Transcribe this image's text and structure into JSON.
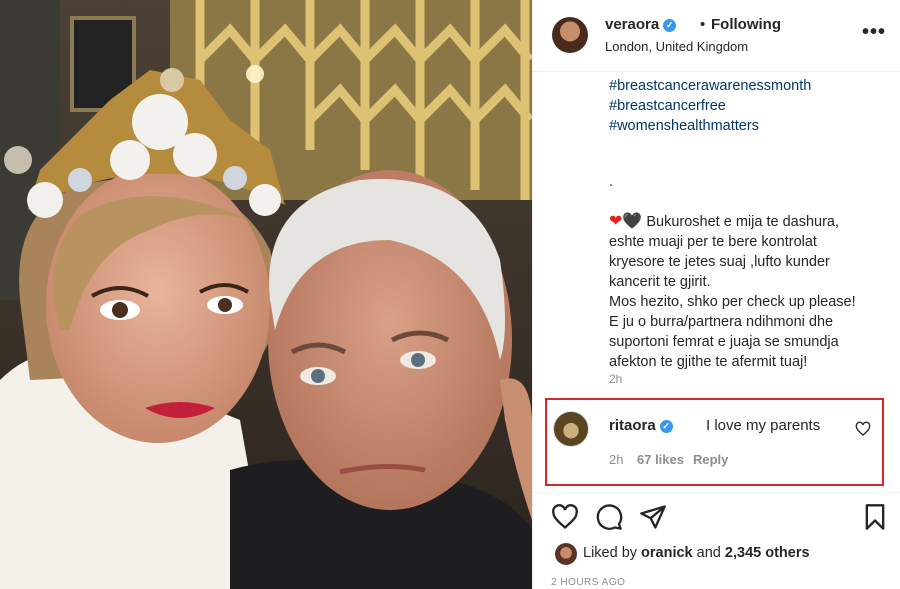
{
  "post": {
    "username": "veraora",
    "separator": "•",
    "follow_status": "Following",
    "location": "London, United Kingdom",
    "more_label": "•••"
  },
  "caption": {
    "hashtags": [
      "#breastcancerawarenessmonth",
      "#breastcancerfree",
      "#womenshealthmatters"
    ],
    "dot": ".",
    "hearts": [
      "❤",
      "🖤"
    ],
    "lines": [
      "Bukuroshet e mija te dashura,",
      "eshte muaji per te bere kontrolat",
      "kryesore te jetes suaj ,lufto kunder",
      "kancerit te gjirit.",
      "Mos hezito, shko per check up please!",
      "E ju o burra/partnera ndihmoni dhe",
      "suportoni femrat e juaja se smundja",
      "afekton te gjithe te afermit tuaj!"
    ],
    "time": "2h"
  },
  "comment": {
    "username": "ritaora",
    "text": "I love my parents",
    "time": "2h",
    "likes": "67 likes",
    "reply": "Reply"
  },
  "likes": {
    "prefix": "Liked by",
    "user": "oranick",
    "joiner": "and",
    "count": "2,345 others"
  },
  "date": "2 HOURS AGO",
  "icons": {
    "verified": "verified-badge-icon",
    "like": "heart-outline-icon",
    "comment": "comment-bubble-icon",
    "share": "paper-plane-icon",
    "save": "bookmark-icon"
  },
  "colors": {
    "hashtag": "#00376b",
    "highlight_border": "#d8262c",
    "verified": "#3897f0",
    "muted": "#8e8e8e"
  }
}
